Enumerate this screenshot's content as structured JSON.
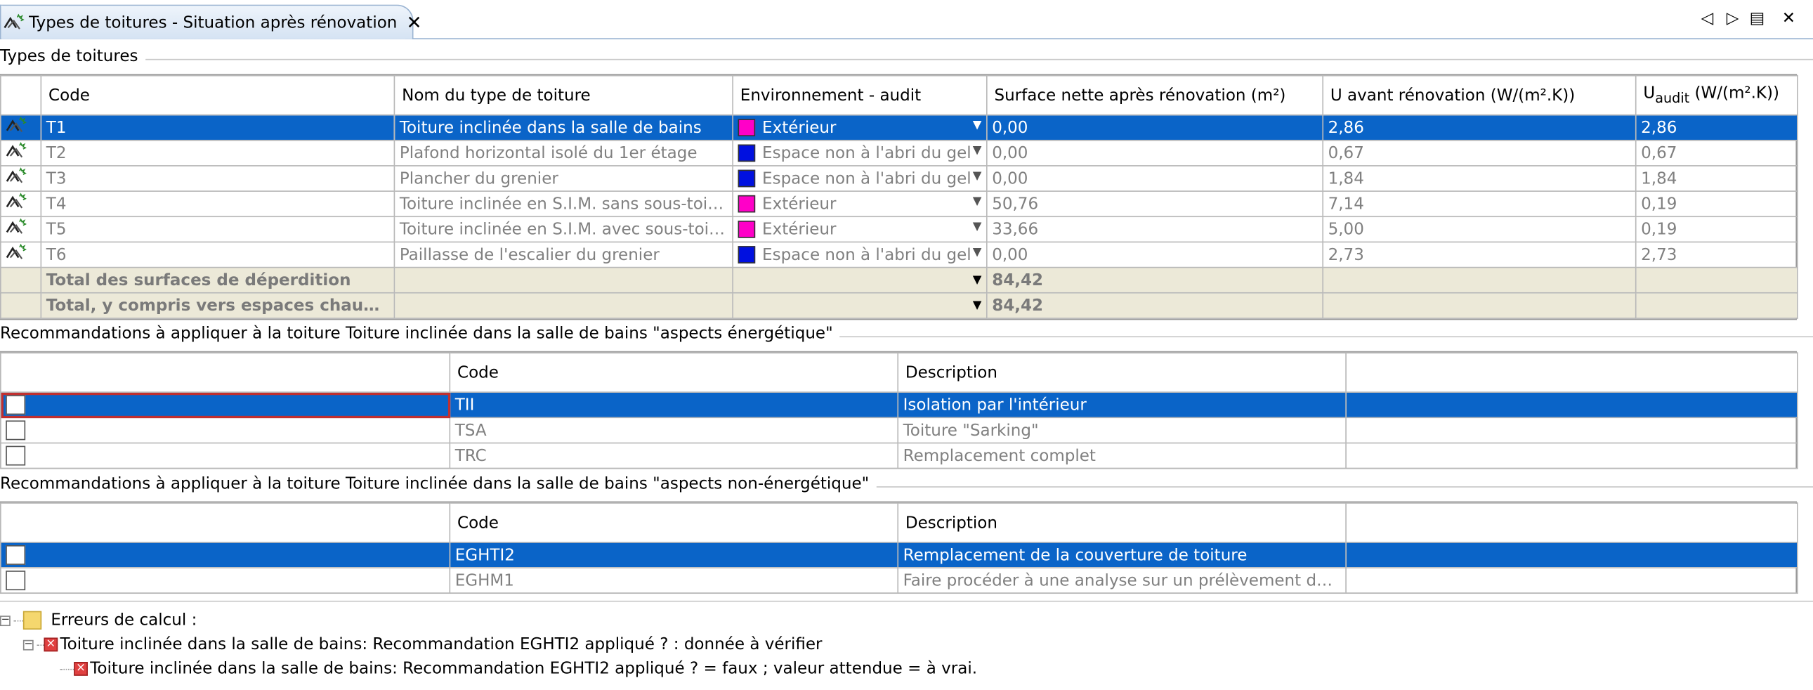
{
  "tab": {
    "title": "Types de toitures - Situation après rénovation",
    "close": "✕",
    "icon": "roof-icon"
  },
  "tab_controls": {
    "left": "◁",
    "right": "▷",
    "menu": "▤",
    "close": "✕"
  },
  "roof_types": {
    "group_title": "Types de toitures",
    "headers": {
      "code": "Code",
      "name": "Nom du type de toiture",
      "environment": "Environnement - audit",
      "surface": "Surface nette après rénovation (m²)",
      "u_before": "U avant rénovation (W/(m².K))",
      "u_audit_base": "U",
      "u_audit_sub": "audit",
      "u_audit_unit": " (W/(m².K))"
    },
    "rows": [
      {
        "code": "T1",
        "name": "Toiture inclinée dans la salle de bains",
        "env": "Extérieur",
        "env_color": "#ff00c8",
        "surface": "0,00",
        "u_before": "2,86",
        "u_audit": "2,86"
      },
      {
        "code": "T2",
        "name": "Plafond horizontal isolé du 1er étage",
        "env": "Espace non à l'abri du gel",
        "env_color": "#0010e0",
        "surface": "0,00",
        "u_before": "0,67",
        "u_audit": "0,67"
      },
      {
        "code": "T3",
        "name": "Plancher du grenier",
        "env": "Espace non à l'abri du gel",
        "env_color": "#0010e0",
        "surface": "0,00",
        "u_before": "1,84",
        "u_audit": "1,84"
      },
      {
        "code": "T4",
        "name": "Toiture inclinée en S.I.M. sans sous-toiture",
        "env": "Extérieur",
        "env_color": "#ff00c8",
        "surface": "50,76",
        "u_before": "7,14",
        "u_audit": "0,19"
      },
      {
        "code": "T5",
        "name": "Toiture inclinée en S.I.M. avec sous-toiture",
        "env": "Extérieur",
        "env_color": "#ff00c8",
        "surface": "33,66",
        "u_before": "5,00",
        "u_audit": "0,19"
      },
      {
        "code": "T6",
        "name": "Paillasse de l'escalier du grenier",
        "env": "Espace non à l'abri du gel",
        "env_color": "#0010e0",
        "surface": "0,00",
        "u_before": "2,73",
        "u_audit": "2,73"
      }
    ],
    "totals": [
      {
        "label": "Total des surfaces de déperdition",
        "surface": "84,42"
      },
      {
        "label": "Total, y compris vers espaces chauffés",
        "surface": "84,42"
      }
    ]
  },
  "reco_energy": {
    "group_title": "Recommandations à appliquer à la toiture Toiture inclinée dans la salle de bains \"aspects énergétique\"",
    "headers": {
      "code": "Code",
      "description": "Description"
    },
    "rows": [
      {
        "code": "TII",
        "description": "Isolation par l'intérieur",
        "checked": false
      },
      {
        "code": "TSA",
        "description": "Toiture \"Sarking\"",
        "checked": false
      },
      {
        "code": "TRC",
        "description": "Remplacement complet",
        "checked": false
      }
    ]
  },
  "reco_non_energy": {
    "group_title": "Recommandations à appliquer à la toiture Toiture inclinée dans la salle de bains \"aspects non-énergétique\"",
    "headers": {
      "code": "Code",
      "description": "Description"
    },
    "rows": [
      {
        "code": "EGHTI2",
        "description": "Remplacement de la couverture de toiture",
        "checked": false
      },
      {
        "code": "EGHM1",
        "description": "Faire procéder à une analyse sur un prélèvement de mo...",
        "checked": false
      }
    ]
  },
  "errors": {
    "root": "Erreurs de calcul :",
    "child": "Toiture inclinée dans la salle de bains: Recommandation EGHTI2 appliqué ? : donnée à vérifier",
    "grandchild": "Toiture inclinée dans la salle de bains: Recommandation EGHTI2 appliqué ? = faux ; valeur attendue = à vrai.",
    "expand_symbol": "−"
  }
}
